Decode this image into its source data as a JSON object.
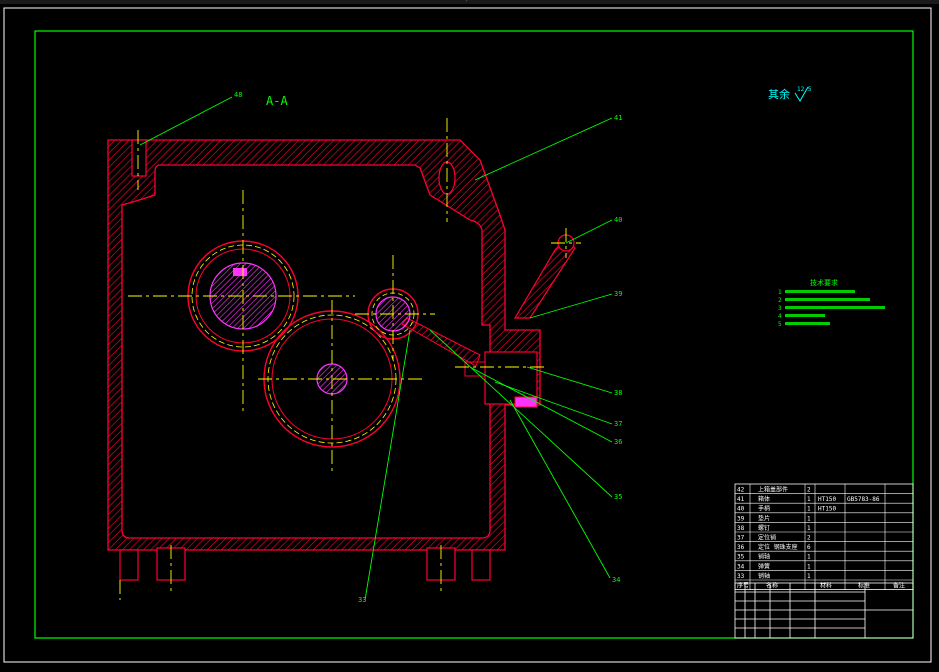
{
  "window": {
    "title_mark": "'"
  },
  "drawing": {
    "section_label": "A-A",
    "roughness_label": "其余",
    "roughness_value": "12.5",
    "tech_title": "技术要求",
    "tech_notes": [
      "1",
      "2",
      "3",
      "4",
      "5"
    ]
  },
  "callouts": [
    {
      "id": "c48",
      "label": "48"
    },
    {
      "id": "c41",
      "label": "41"
    },
    {
      "id": "c40",
      "label": "40"
    },
    {
      "id": "c39",
      "label": "39"
    },
    {
      "id": "c38",
      "label": "38"
    },
    {
      "id": "c37",
      "label": "37"
    },
    {
      "id": "c36",
      "label": "36"
    },
    {
      "id": "c35",
      "label": "35"
    },
    {
      "id": "c34",
      "label": "34"
    },
    {
      "id": "c33",
      "label": "33"
    }
  ],
  "bom": {
    "rows": [
      {
        "no": "42",
        "name": "上箱盖部件",
        "qty": "2",
        "mat": "",
        "std": ""
      },
      {
        "no": "41",
        "name": "箱体",
        "qty": "1",
        "mat": "HT150",
        "std": "GB5783-86"
      },
      {
        "no": "40",
        "name": "手柄",
        "qty": "1",
        "mat": "HT150",
        "std": ""
      },
      {
        "no": "39",
        "name": "垫片",
        "qty": "1",
        "mat": "",
        "std": ""
      },
      {
        "no": "38",
        "name": "螺钉",
        "qty": "1",
        "mat": "",
        "std": ""
      },
      {
        "no": "37",
        "name": "定位销",
        "qty": "2",
        "mat": "",
        "std": ""
      },
      {
        "no": "36",
        "name": "定位 钢珠支座",
        "qty": "6",
        "mat": "",
        "std": ""
      },
      {
        "no": "35",
        "name": "销轴",
        "qty": "1",
        "mat": "",
        "std": ""
      },
      {
        "no": "34",
        "name": "弹簧",
        "qty": "1",
        "mat": "",
        "std": ""
      },
      {
        "no": "33",
        "name": "销轴",
        "qty": "1",
        "mat": "",
        "std": ""
      }
    ],
    "header": {
      "no": "序号",
      "name": "名称",
      "qty": "",
      "mat": "材料",
      "std": "标准",
      "note": "备注"
    }
  },
  "colors": {
    "frame": "#00ff00",
    "part": "#ff0033",
    "center": "#ffff00",
    "leader": "#00ff00",
    "hub": "#ff33ff",
    "text_cyan": "#00ffff",
    "table": "#ffffff"
  }
}
